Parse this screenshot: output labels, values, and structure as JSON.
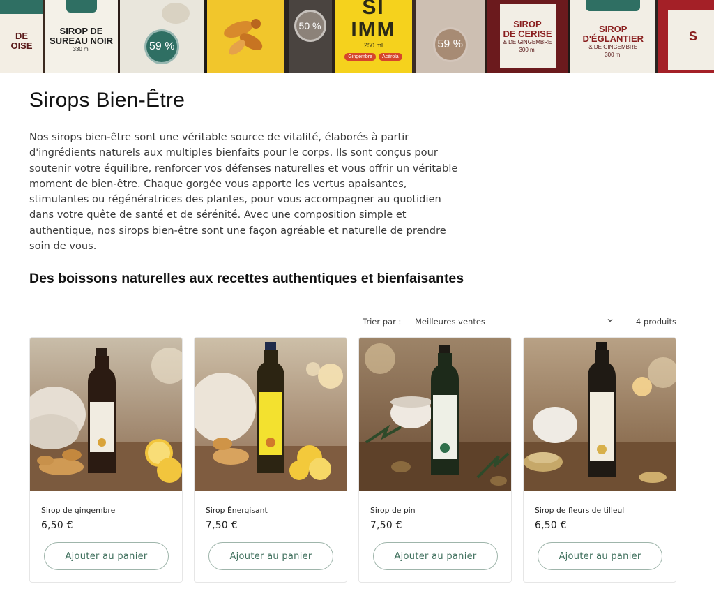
{
  "banner": {
    "bottles": [
      {
        "text": "DE\nOISE",
        "bg": "#f3eee4",
        "fg": "#5a1a1a"
      },
      {
        "text": "SIROP DE\nSUREAU NOIR",
        "sub": "330 ml",
        "bg": "#f4f1e8",
        "fg": "#1f1f1f"
      },
      {
        "text": "59 %",
        "badge": true,
        "bg": "#e9e6dc",
        "badgeColor": "#2f6f63"
      },
      {
        "text": "",
        "bg": "#f1c62c",
        "fg": "#7a4a12"
      },
      {
        "text": "50 %",
        "badge": true,
        "bg": "#4a4440",
        "badgeColor": "#8c8279"
      },
      {
        "text": "SI\nIMM",
        "sub": "250 ml",
        "bg": "#f5d21d",
        "fg": "#2c2a17",
        "tags": [
          "Gingembre",
          "Acérola"
        ]
      },
      {
        "text": "59 %",
        "badge": true,
        "bg": "#cdbfb2",
        "badgeColor": "#a78b74"
      },
      {
        "text": "SIROP\nDE CERISE",
        "sub": "& DE GINGEMBRE",
        "sub2": "300 ml",
        "bg": "#6b1a1d",
        "fg": "#ffffff"
      },
      {
        "text": "SIROP\nD'ÉGLANTIER",
        "sub": "& DE GINGEMBRE",
        "sub2": "300 ml",
        "bg": "#f2eee5",
        "fg": "#8a1f1f"
      },
      {
        "text": "S",
        "bg": "#a42027",
        "fg": "#ffffff"
      }
    ]
  },
  "page": {
    "title": "Sirops Bien-Être",
    "description": "Nos sirops bien-être sont une véritable source de vitalité, élaborés à partir d'ingrédients naturels aux multiples bienfaits pour le corps. Ils sont conçus pour soutenir votre équilibre, renforcer vos défenses naturelles et vous offrir un véritable moment de bien-être. Chaque gorgée vous apporte les vertus apaisantes, stimulantes ou régénératrices des plantes, pour vous accompagner au quotidien dans votre quête de santé et de sérénité. Avec une composition simple et authentique, nos sirops bien-être sont une façon agréable et naturelle de prendre soin de vous.",
    "subtitle": "Des boissons naturelles aux recettes authentiques et bienfaisantes"
  },
  "sort": {
    "label": "Trier par :",
    "value": "Meilleures ventes",
    "count": "4 produits"
  },
  "products": [
    {
      "name": "Sirop de gingembre",
      "price": "6,50 €",
      "button": "Ajouter au panier",
      "labelColor": "#f1ece1",
      "accent": "#d9a33a",
      "icon": "ginger-icon"
    },
    {
      "name": "Sirop Énergisant",
      "price": "7,50 €",
      "button": "Ajouter au panier",
      "labelColor": "#f3e12f",
      "accent": "#d17a2b",
      "icon": "energy-icon"
    },
    {
      "name": "Sirop de pin",
      "price": "7,50 €",
      "button": "Ajouter au panier",
      "labelColor": "#eef0e6",
      "accent": "#2f6f4a",
      "icon": "pine-icon"
    },
    {
      "name": "Sirop de fleurs de tilleul",
      "price": "6,50 €",
      "button": "Ajouter au panier",
      "labelColor": "#f2ede0",
      "accent": "#d8b04a",
      "icon": "linden-flower-icon"
    }
  ],
  "colors": {
    "button_text": "#3e6f5c",
    "button_border": "#9fb5ab"
  }
}
